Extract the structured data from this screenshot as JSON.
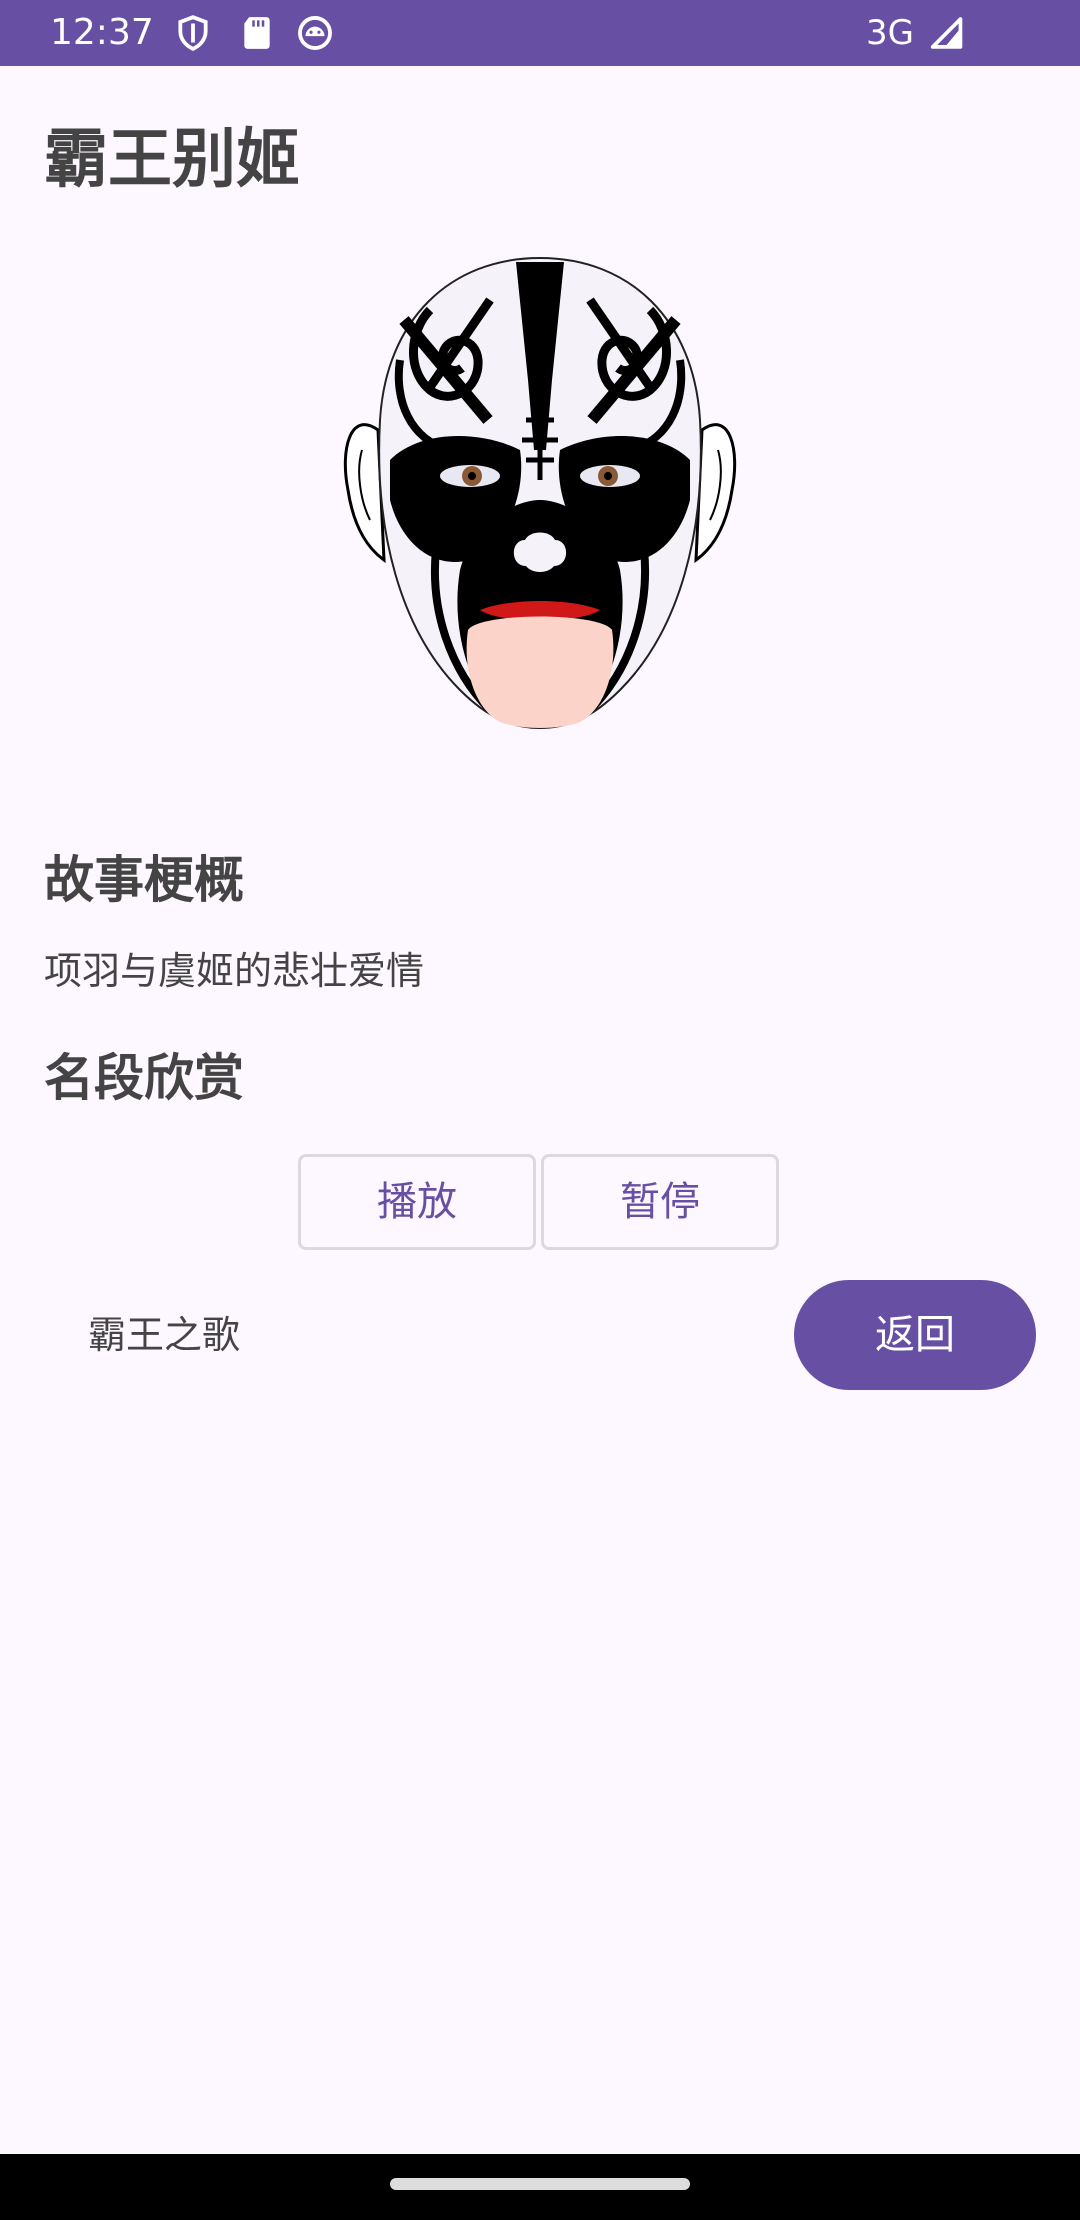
{
  "status_bar": {
    "time": "12:37",
    "network": "3G",
    "icons": [
      "shield-icon",
      "sd-card-icon",
      "android-face-icon",
      "signal-icon"
    ]
  },
  "page": {
    "title": "霸王别姬",
    "mask_image": "peking-opera-mask"
  },
  "story": {
    "heading": "故事梗概",
    "text": "项羽与虞姬的悲壮爱情"
  },
  "excerpt": {
    "heading": "名段欣赏",
    "play_label": "播放",
    "pause_label": "暂停",
    "song_name": "霸王之歌"
  },
  "actions": {
    "back_label": "返回"
  },
  "colors": {
    "accent": "#6750A4",
    "background": "#FDF7FF",
    "text": "#444444"
  }
}
